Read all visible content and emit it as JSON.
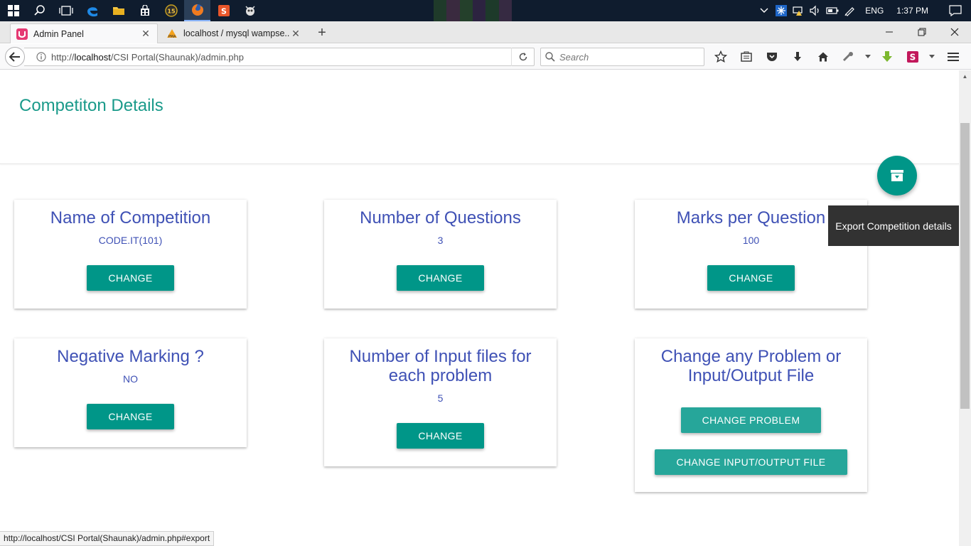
{
  "taskbar": {
    "icons": [
      "windows-start-icon",
      "search-icon",
      "task-view-icon",
      "edge-icon",
      "file-explorer-icon",
      "store-icon",
      "app-15-icon",
      "firefox-icon",
      "app-s-icon",
      "app-dev-icon"
    ],
    "language": "ENG",
    "time": "1:37 PM"
  },
  "browser": {
    "tabs": [
      {
        "title": "Admin Panel",
        "active": true
      },
      {
        "title": "localhost / mysql wampse...",
        "active": false
      }
    ],
    "url_prefix": "http://",
    "url_host": "localhost",
    "url_path": "/CSI Portal(Shaunak)/admin.php",
    "search_placeholder": "Search",
    "status_url": "http://localhost/CSI Portal(Shaunak)/admin.php#export"
  },
  "page": {
    "title": "Competiton Details",
    "fab_tooltip": "Export Competition details",
    "cards": [
      {
        "title": "Name of Competition",
        "value": "CODE.IT(101)",
        "button": "CHANGE"
      },
      {
        "title": "Number of Questions",
        "value": "3",
        "button": "CHANGE"
      },
      {
        "title": "Marks per Question",
        "value": "100",
        "button": "CHANGE"
      },
      {
        "title": "Negative Marking ?",
        "value": "NO",
        "button": "CHANGE"
      },
      {
        "title": "Number of Input files for each problem",
        "value": "5",
        "button": "CHANGE"
      },
      {
        "title": "Change any Problem or Input/Output File",
        "buttons": [
          "CHANGE PROBLEM",
          "CHANGE INPUT/OUTPUT FILE"
        ]
      }
    ]
  },
  "colors": {
    "accent": "#009688",
    "title_teal": "#1a9a8a",
    "card_text": "#3f51b5",
    "taskbar": "#0f1c2e"
  }
}
